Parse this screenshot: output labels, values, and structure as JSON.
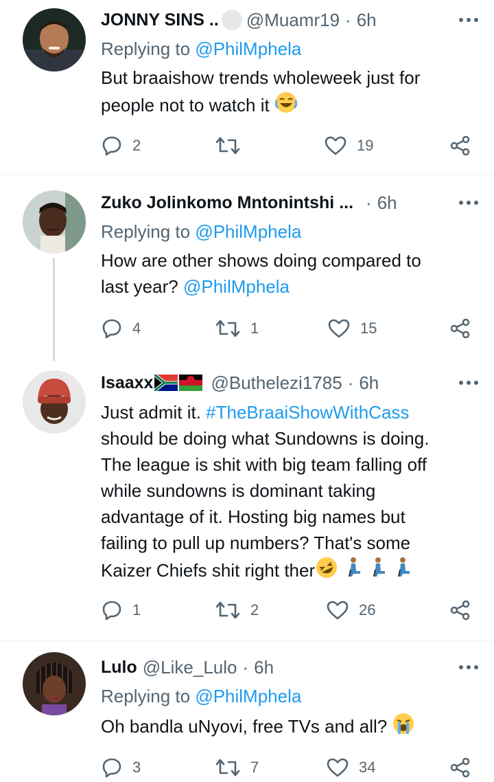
{
  "colors": {
    "link": "#1d9bf0",
    "muted": "#536471",
    "text": "#0f1419",
    "divider": "#eff3f4",
    "thread": "#cfd9de"
  },
  "tweets": [
    {
      "name": "JONNY SINS ..",
      "handle": "@Muamr19",
      "time": "6h",
      "replying_label": "Replying to",
      "replying_to": "@PhilMphela",
      "lines": [
        "But braaishow trends wholeweek just for",
        "people not to watch it"
      ],
      "trailing_emoji": "face-with-tears-of-joy",
      "replies": "2",
      "retweets": "",
      "likes": "19"
    },
    {
      "name": "Zuko Jolinkomo Mntonintshi ...",
      "handle": "",
      "time": "6h",
      "replying_label": "Replying to",
      "replying_to": "@PhilMphela",
      "line1": "How are other shows doing compared to",
      "line2_text": "last year?",
      "line2_mention": "@PhilMphela",
      "replies": "4",
      "retweets": "1",
      "likes": "15"
    },
    {
      "name": "Isaaxx",
      "handle": "@Buthelezi1785",
      "time": "6h",
      "line1_text": "Just admit it.",
      "line1_hashtag": "#TheBraaiShowWithCass",
      "lines": [
        "should be doing what Sundowns is doing.",
        "The league is shit with big team falling off",
        "while sundowns is dominant  taking",
        "advantage of it. Hosting big names but",
        "failing to pull up numbers? That's some"
      ],
      "last_line": "Kaizer Chiefs shit right ther",
      "replies": "1",
      "retweets": "2",
      "likes": "26"
    },
    {
      "name": "Lulo",
      "handle": "@Like_Lulo",
      "time": "6h",
      "replying_label": "Replying to",
      "replying_to": "@PhilMphela",
      "line1": "Oh bandla uNyovi, free TVs and all?",
      "trailing_emoji": "loudly-crying-face",
      "replies": "3",
      "retweets": "7",
      "likes": "34"
    }
  ]
}
